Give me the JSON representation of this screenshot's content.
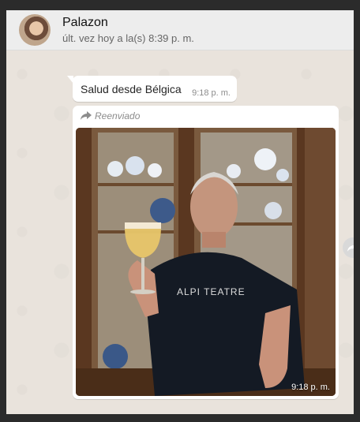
{
  "header": {
    "contact_name": "Palazon",
    "last_seen": "últ. vez hoy a la(s) 8:39 p. m."
  },
  "messages": [
    {
      "text": "Salud desde Bélgica",
      "time": "9:18 p. m."
    },
    {
      "forwarded_label": "Reenviado",
      "image_caption_text": "ALPI TEATRE",
      "time": "9:18 p. m."
    }
  ],
  "icons": {
    "forwarded": "forward-arrow-icon",
    "share": "share-icon"
  },
  "colors": {
    "chat_background": "#e9e3dc",
    "header_background": "#ededed",
    "bubble_background": "#ffffff"
  }
}
